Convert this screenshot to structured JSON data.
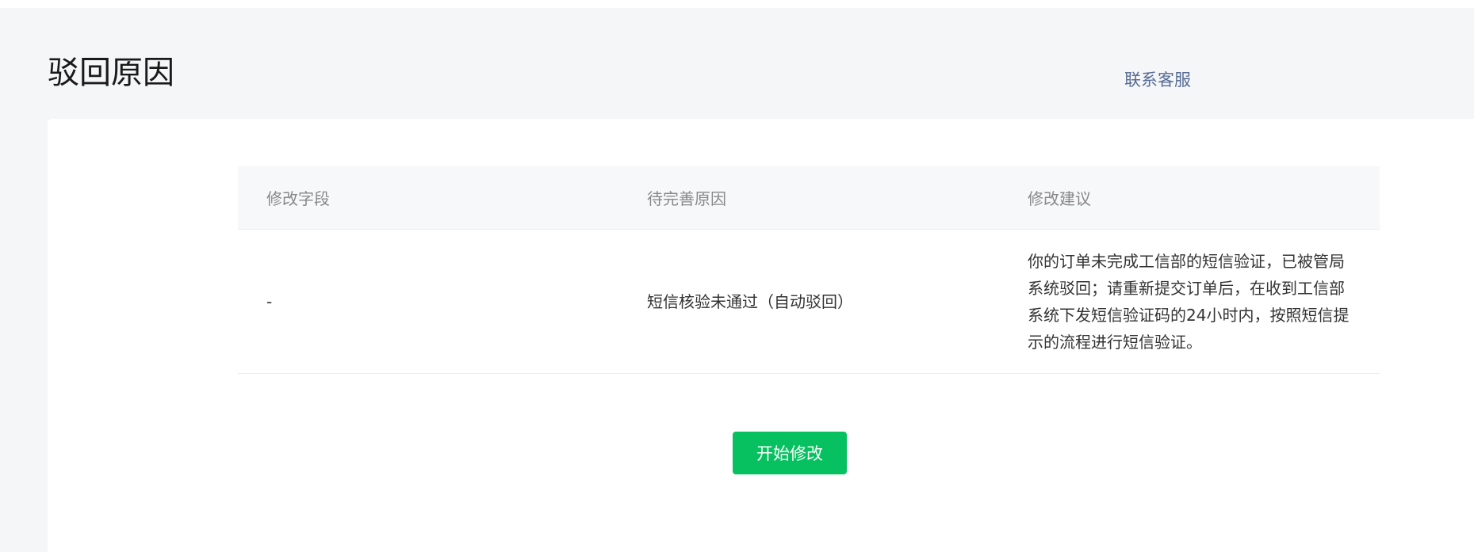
{
  "header": {
    "title": "驳回原因",
    "contact_link": "联系客服"
  },
  "table": {
    "columns": [
      "修改字段",
      "待完善原因",
      "修改建议"
    ],
    "rows": [
      {
        "field": "-",
        "reason": "短信核验未通过（自动驳回）",
        "suggestion": "你的订单未完成工信部的短信验证，已被管局系统驳回；请重新提交订单后，在收到工信部系统下发短信验证码的24小时内，按照短信提示的流程进行短信验证。"
      }
    ]
  },
  "actions": {
    "start_edit_label": "开始修改"
  },
  "colors": {
    "primary": "#07c160",
    "link": "#576b95",
    "background": "#f5f6f7"
  }
}
